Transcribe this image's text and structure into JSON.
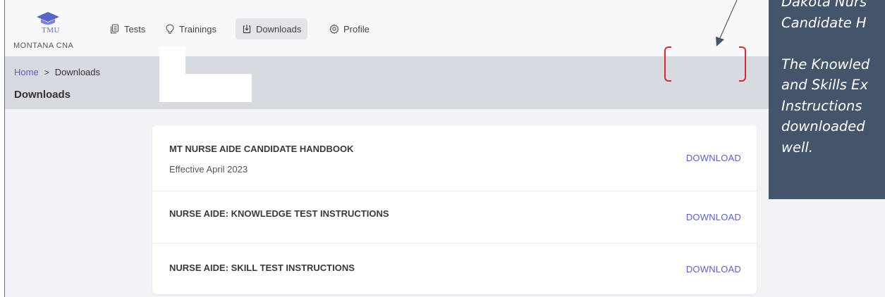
{
  "brand": {
    "logo_text": "TMU",
    "subtitle": "MONTANA CNA"
  },
  "nav": {
    "items": [
      {
        "label": "Tests",
        "icon": "document-stack-icon",
        "active": false
      },
      {
        "label": "Trainings",
        "icon": "lightbulb-icon",
        "active": false
      },
      {
        "label": "Downloads",
        "icon": "download-tray-icon",
        "active": true
      },
      {
        "label": "Profile",
        "icon": "gear-icon",
        "active": false
      }
    ]
  },
  "breadcrumb": {
    "home": "Home",
    "separator": ">",
    "current": "Downloads"
  },
  "page": {
    "title": "Downloads"
  },
  "downloads": [
    {
      "title": "MT NURSE AIDE CANDIDATE HANDBOOK",
      "subtitle": "Effective April 2023",
      "action": "DOWNLOAD"
    },
    {
      "title": "NURSE AIDE: KNOWLEDGE TEST INSTRUCTIONS",
      "subtitle": "",
      "action": "DOWNLOAD"
    },
    {
      "title": "NURSE AIDE: SKILL TEST INSTRUCTIONS",
      "subtitle": "",
      "action": "DOWNLOAD"
    }
  ],
  "annotation": {
    "text": "Dakota Nurs\nCandidate H\n\nThe Knowled\nand Skills Ex\nInstructions \ndownloaded\nwell."
  },
  "colors": {
    "accent": "#5b5fc7",
    "callout_bg": "#44546a",
    "bracket": "#e0262a"
  }
}
